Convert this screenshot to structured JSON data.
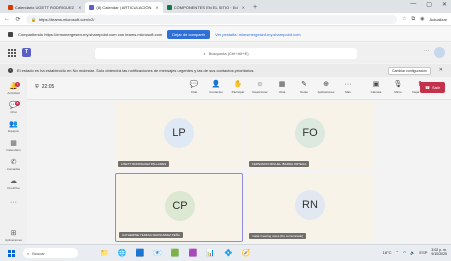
{
  "browser": {
    "tabs": [
      {
        "label": "Calendario UGETT RODRIGUEZ",
        "color": "#d83b01"
      },
      {
        "label": "(8) Calendar | ARTICULACIÓN",
        "color": "#5b5fc7"
      },
      {
        "label": "COMPONENTES EN EL SITIO · Ed",
        "color": "#107c41"
      }
    ],
    "new_tab": "+",
    "window_controls": [
      "—",
      "▢",
      "✕"
    ],
    "address": "https://teams.microsoft.com/v2/",
    "extension_label": "Actualizar"
  },
  "share_banner": {
    "text": "Compartiendo https://emomergesen-my.sharepoint.com con teams.microsoft.com",
    "stop_label": "Dejar de compartir",
    "hide_label": "Ver pestaña: mimsmergesinf-my.sharepoint.com"
  },
  "teams_header": {
    "logo": "T",
    "search_placeholder": "Búsqueda (Ctrl+Alt+E)",
    "more": "···"
  },
  "notification": {
    "text": "El estado es ha establecido en No molestar. Solo obtendrá las notificaciones de mensajes urgentes y las de sus contactos prioritarios.",
    "config_label": "Cambiar configuración",
    "close": "✕"
  },
  "rail": [
    {
      "label": "Actividad",
      "icon": "bell-icon",
      "glyph": "🔔",
      "badge": "1"
    },
    {
      "label": "Chat",
      "icon": "chat-icon",
      "glyph": "💬",
      "badge": "8"
    },
    {
      "label": "Equipos",
      "icon": "teams-icon",
      "glyph": "👥",
      "badge": ""
    },
    {
      "label": "Calendario",
      "icon": "calendar-icon",
      "glyph": "▦",
      "badge": ""
    },
    {
      "label": "Llamadas",
      "icon": "phone-icon",
      "glyph": "✆",
      "badge": ""
    },
    {
      "label": "OneDrive",
      "icon": "cloud-icon",
      "glyph": "☁",
      "badge": ""
    },
    {
      "label": "···",
      "icon": "more-icon",
      "glyph": "",
      "badge": ""
    },
    {
      "label": "Aplicaciones",
      "icon": "apps-icon",
      "glyph": "⊞",
      "badge": ""
    }
  ],
  "meeting": {
    "timer": "22:05",
    "tools": [
      {
        "label": "Chat",
        "glyph": "💬",
        "icon": "chat-icon"
      },
      {
        "label": "Contactos",
        "glyph": "👤",
        "icon": "people-icon"
      },
      {
        "label": "Participar",
        "glyph": "✋",
        "icon": "raise-hand-icon"
      },
      {
        "label": "Reaccionar",
        "glyph": "☺",
        "icon": "react-icon"
      },
      {
        "label": "Vista",
        "glyph": "▦",
        "icon": "view-icon"
      },
      {
        "label": "Notas",
        "glyph": "✎",
        "icon": "notes-icon"
      },
      {
        "label": "Aplicaciones",
        "glyph": "⊕",
        "icon": "apps-icon"
      },
      {
        "label": "Más",
        "glyph": "···",
        "icon": "more-icon"
      }
    ],
    "tools_right": [
      {
        "label": "Cámara",
        "glyph": "▣",
        "icon": "camera-icon"
      },
      {
        "label": "Micro",
        "glyph": "🎙",
        "icon": "mic-icon"
      },
      {
        "label": "Dejar de co",
        "glyph": "⬆",
        "icon": "share-icon"
      }
    ],
    "leave_label": "Salir"
  },
  "participants": [
    {
      "initials": "LP",
      "name": "LISETT RODRIGUEZ PALLARES"
    },
    {
      "initials": "FO",
      "name": "FERNANDO MIGUEL IBARRA ORTEGA"
    },
    {
      "initials": "CP",
      "name": "CATHERINE TERESA FERNANDEZ PEÑA"
    },
    {
      "initials": "RN",
      "name": "rnalar meeting notes (No comunicado)"
    }
  ],
  "taskbar": {
    "search_placeholder": "Buscar",
    "apps": [
      "📁",
      "🌐",
      "🟦",
      "📧",
      "🟩",
      "🟪",
      "📊",
      "💠",
      "🧭"
    ],
    "weather": "18°C",
    "time": "3:02 p. m.",
    "date": "9/10/2025",
    "language": "ESP"
  }
}
